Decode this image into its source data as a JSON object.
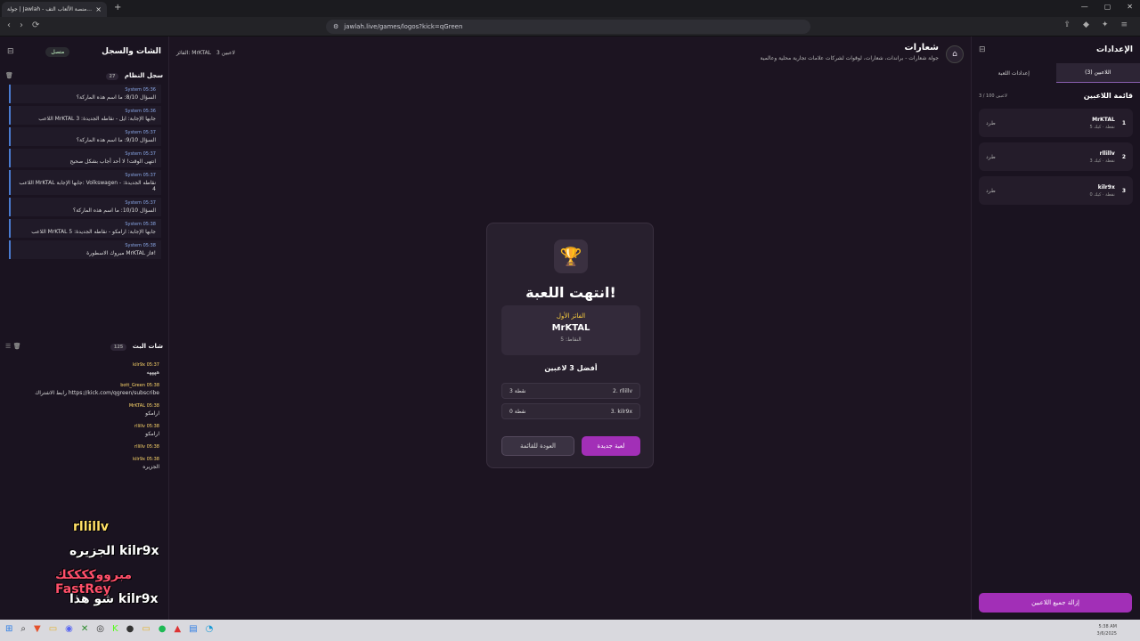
{
  "browser": {
    "tab_title": "جولة | Jawlah - منصة الألعاب التف...",
    "tab_close": "×",
    "new_tab": "+",
    "url": "jawlah.live/games/logos?kick=qGreen",
    "back": "‹",
    "forward": "›",
    "reload": "⟳"
  },
  "left_panel": {
    "title": "الشات والسجل",
    "connection": "متصل",
    "system_log": {
      "title": "سجل النظام",
      "count": "27",
      "entries": [
        {
          "meta": "System 05:36",
          "text": "السؤال 8/10: ما اسم هذه الماركة؟"
        },
        {
          "meta": "System 05:36",
          "text": "اللاعب MrKTAL جابها الإجابة: ايل - نقاطه الجديدة: 3"
        },
        {
          "meta": "System 05:37",
          "text": "السؤال 9/10: ما اسم هذه الماركة؟"
        },
        {
          "meta": "System 05:37",
          "text": "انتهى الوقت! لا أحد أجاب بشكل صحيح"
        },
        {
          "meta": "System 05:37",
          "text": "اللاعب MrKTAL جابها الإجابة: Volkswagen - نقاطه الجديدة: 4"
        },
        {
          "meta": "System 05:37",
          "text": "السؤال 10/10: ما اسم هذه الماركة؟"
        },
        {
          "meta": "System 05:38",
          "text": "اللاعب MrKTAL جابها الإجابة: ارامكو - نقاطه الجديدة: 5"
        },
        {
          "meta": "System 05:38",
          "text": "مبروك الاسطورة MrKTAL فاز!"
        }
      ]
    },
    "live_chat": {
      "title": "شات البث",
      "count": "125",
      "messages": [
        {
          "who": "kilr9x 05:37",
          "text": "ههههه"
        },
        {
          "who": "bott_Green 05:38",
          "text": "رابط الاشتراك https://kick.com/qgreen/subscribe"
        },
        {
          "who": "MrKTAL 05:38",
          "text": "ارامكو"
        },
        {
          "who": "rllillv 05:38",
          "text": "ارامكو"
        },
        {
          "who": "rllillv 05:38",
          "text": ""
        },
        {
          "who": "kilr9x 05:38",
          "text": "الجزيره"
        }
      ]
    },
    "overlay": [
      "rllillv",
      "الجزيره kilr9x",
      "مبرووككككك FastRey",
      "شو هذا kilr9x"
    ]
  },
  "center": {
    "game_title": "شعارات",
    "game_subtitle": "جولة شعارات - براندات، شعارات، لوقوات لشركات علامات تجارية محلية وعالمية",
    "status_players": "3 لاعبين",
    "status_winner": "الفائز: MrKTAL",
    "modal": {
      "title": "انتهت اللعبة!",
      "winner_label": "الفائز الأول",
      "winner_name": "MrKTAL",
      "winner_points": "النقاط: 5",
      "top_label": "أفضل 3 لاعبين",
      "ranks": [
        {
          "name": "2. rllillv",
          "points": "3 نقطة"
        },
        {
          "name": "3. kilr9x",
          "points": "0 نقطة"
        }
      ],
      "new_game": "لعبة جديدة",
      "back": "العودة للقائمة"
    }
  },
  "right_panel": {
    "title": "الإعدادات",
    "tabs": [
      "اللاعبين (3)",
      "إعدادات اللعبة"
    ],
    "list_title": "قائمة اللاعبين",
    "list_count": "3 / 100 لاعبين",
    "players": [
      {
        "rank": "1",
        "name": "MrKTAL",
        "points": "5 نقطة · كيك",
        "kick": "طرد"
      },
      {
        "rank": "2",
        "name": "rllillv",
        "points": "3 نقطة · كيك",
        "kick": "طرد"
      },
      {
        "rank": "3",
        "name": "kilr9x",
        "points": "0 نقطة · كيك",
        "kick": "طرد"
      }
    ],
    "remove_all": "إزالة جميع اللاعبين"
  },
  "taskbar": {
    "time": "5:38 AM",
    "date": "3/6/2025"
  }
}
